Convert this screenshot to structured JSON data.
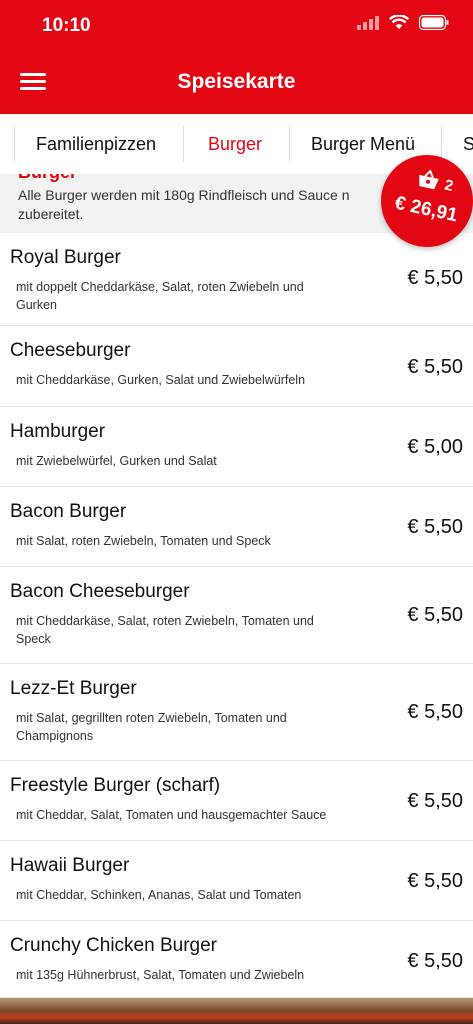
{
  "status": {
    "time": "10:10"
  },
  "header": {
    "title": "Speisekarte"
  },
  "tabs": [
    "Familienpizzen",
    "Burger",
    "Burger Menü",
    "S"
  ],
  "active_tab": "Burger",
  "section": {
    "title": "Burger",
    "description": "Alle Burger werden mit 180g Rindfleisch und Sauce n zubereitet."
  },
  "cart": {
    "count": "2",
    "total": "€ 26,91"
  },
  "items": [
    {
      "name": "Royal Burger",
      "desc": "mit doppelt Cheddarkäse, Salat, roten Zwiebeln und Gurken",
      "price": "€ 5,50"
    },
    {
      "name": "Cheeseburger",
      "desc": "mit Cheddarkäse, Gurken, Salat und Zwiebelwürfeln",
      "price": "€ 5,50"
    },
    {
      "name": "Hamburger",
      "desc": "mit Zwiebelwürfel, Gurken und Salat",
      "price": "€ 5,00"
    },
    {
      "name": "Bacon Burger",
      "desc": "mit Salat, roten Zwiebeln, Tomaten und Speck",
      "price": "€ 5,50"
    },
    {
      "name": "Bacon Cheeseburger",
      "desc": "mit Cheddarkäse, Salat, roten Zwiebeln, Tomaten und Speck",
      "price": "€ 5,50"
    },
    {
      "name": "Lezz-Et Burger",
      "desc": "mit Salat, gegrillten roten Zwiebeln, Tomaten und Champignons",
      "price": "€ 5,50"
    },
    {
      "name": "Freestyle Burger (scharf)",
      "desc": "mit Cheddar, Salat, Tomaten und hausgemachter Sauce",
      "price": "€ 5,50"
    },
    {
      "name": "Hawaii Burger",
      "desc": "mit Cheddar, Schinken, Ananas, Salat und Tomaten",
      "price": "€ 5,50"
    },
    {
      "name": "Crunchy Chicken Burger",
      "desc": "mit 135g Hühnerbrust, Salat, Tomaten und Zwiebeln",
      "price": "€ 5,50"
    }
  ],
  "colors": {
    "brand": "#e30613",
    "background": "#f2f2f2"
  }
}
